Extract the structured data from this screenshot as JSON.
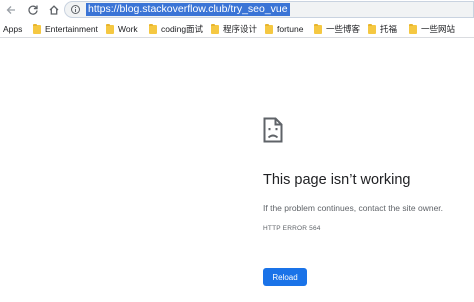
{
  "toolbar": {
    "back_icon": "arrow-left-icon",
    "reload_icon": "reload-icon",
    "home_icon": "home-icon",
    "url": "https://blog.stackoverflow.club/try_seo_vue",
    "url_selected": true
  },
  "bookmarks": {
    "items": [
      {
        "label": "Apps",
        "icon": "apps-grid-icon"
      },
      {
        "label": "Entertainment",
        "icon": "folder-icon"
      },
      {
        "label": "Work",
        "icon": "folder-icon"
      },
      {
        "label": "coding面试",
        "icon": "folder-icon"
      },
      {
        "label": "程序设计",
        "icon": "folder-icon"
      },
      {
        "label": "fortune",
        "icon": "folder-icon"
      },
      {
        "label": "一些博客",
        "icon": "folder-icon"
      },
      {
        "label": "托福",
        "icon": "folder-icon"
      },
      {
        "label": "一些网站",
        "icon": "folder-icon"
      }
    ]
  },
  "error": {
    "icon": "sad-document-icon",
    "title": "This page isn’t working",
    "description": "If the problem continues, contact the site owner.",
    "code": "HTTP ERROR 564",
    "reload_label": "Reload"
  },
  "colors": {
    "accent": "#1a73e8",
    "selection": "#3a74d6",
    "folder": "#f5c842",
    "text_primary": "#202124",
    "text_secondary": "#5f6368"
  }
}
